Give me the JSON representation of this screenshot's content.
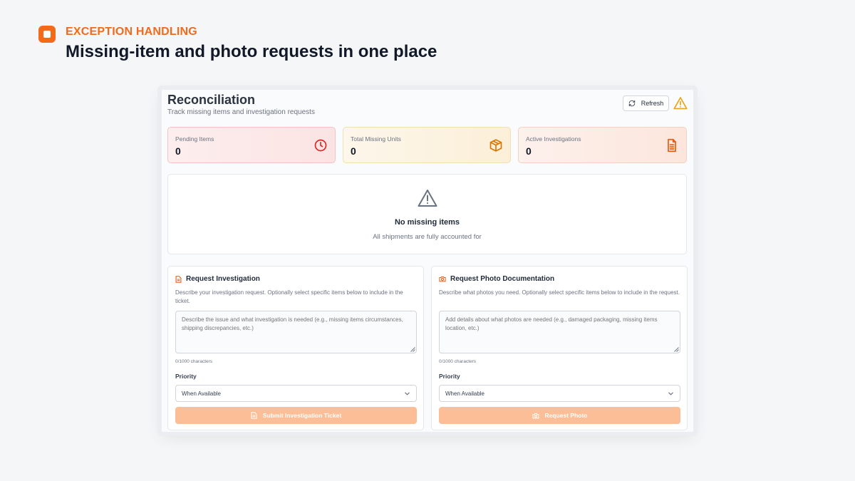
{
  "hero": {
    "eyebrow": "EXCEPTION HANDLING",
    "headline": "Missing-item and photo requests in one place"
  },
  "header": {
    "title": "Reconciliation",
    "subtitle": "Track missing items and investigation requests",
    "refresh_label": "Refresh"
  },
  "stats": [
    {
      "label": "Pending Items",
      "value": "0",
      "icon": "clock-icon",
      "color": "#dc2626"
    },
    {
      "label": "Total Missing Units",
      "value": "0",
      "icon": "box-icon",
      "color": "#d97706"
    },
    {
      "label": "Active Investigations",
      "value": "0",
      "icon": "document-icon",
      "color": "#ea580c"
    }
  ],
  "empty_state": {
    "title": "No missing items",
    "message": "All shipments are fully accounted for"
  },
  "investigation": {
    "title": "Request Investigation",
    "description": "Describe your investigation request. Optionally select specific items below to include in the ticket.",
    "placeholder": "Describe the issue and what investigation is needed (e.g., missing items circumstances, shipping discrepancies, etc.)",
    "char_count": "0/1000 characters",
    "priority_label": "Priority",
    "priority_value": "When Available",
    "submit_label": "Submit Investigation Ticket"
  },
  "photo": {
    "title": "Request Photo Documentation",
    "description": "Describe what photos you need. Optionally select specific items below to include in the request.",
    "placeholder": "Add details about what photos are needed (e.g., damaged packaging, missing items location, etc.)",
    "char_count": "0/1000 characters",
    "priority_label": "Priority",
    "priority_value": "When Available",
    "submit_label": "Request Photo"
  },
  "colors": {
    "accent": "#f46a1b",
    "button_disabled": "#fbbe96"
  }
}
